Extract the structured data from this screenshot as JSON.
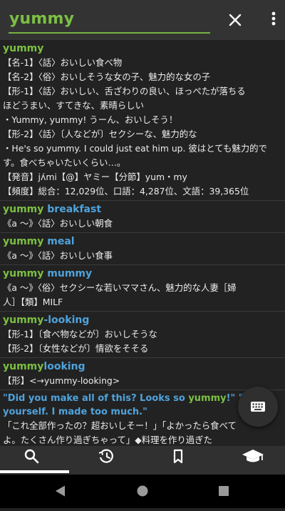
{
  "search": {
    "query": "yummy"
  },
  "icons": {
    "close": "close-icon",
    "menu": "more-vert-icon",
    "keyboard": "keyboard-icon",
    "nav": [
      "search-icon",
      "history-icon",
      "bookmark-icon",
      "school-icon"
    ],
    "system": [
      "back-icon",
      "home-icon",
      "recents-icon"
    ]
  },
  "colors": {
    "headword_green": "#7cc043",
    "headword_blue": "#4fa3dc",
    "background": "#222222"
  },
  "entries": {
    "e1": {
      "headword": "yummy",
      "lines": [
        "【名-1】〈話〉おいしい食べ物",
        "【名-2】〈俗〉おいしそうな女の子、魅力的な女の子",
        "【形-1】〈話〉おいしい、舌ざわりの良い、ほっぺたが落ちる",
        "ほどうまい、すてきな、素晴らしい",
        "・Yummy, yummy! うーん、おいしそう！",
        "【形-2】〈話〉〔人などが〕セクシーな、魅力的な",
        "・He's so yummy. I could just eat him up. 彼はとても魅力的で",
        "す。食べちゃいたいくらい…。",
        "【発音】jʌ́mi【@】ヤミー【分節】yum・my",
        "【頻度】総合：12,029位、口語：4,287位、文語：39,365位"
      ]
    },
    "e2": {
      "hw_green": "yummy",
      "hw_blue": " breakfast",
      "lines": [
        "《a ～》〈話〉おいしい朝食"
      ]
    },
    "e3": {
      "hw_green": "yummy",
      "hw_blue": " meal",
      "lines": [
        "《a ～》〈話〉おいしい食事"
      ]
    },
    "e4": {
      "hw_green": "yummy",
      "hw_blue": " mummy",
      "lines": [
        "《a ～》〈俗〉セクシーな若いママさん、魅力的な人妻［婦",
        "人］【類】MILF"
      ]
    },
    "e5": {
      "hw_green": "yummy",
      "hw_blue": "-looking",
      "lines": [
        "【形-1】〔食べ物などが〕おいしそうな",
        "【形-2】〔女性などが〕情欲をそそる"
      ]
    },
    "e6": {
      "hw_green": "yummy",
      "hw_blue": "looking",
      "lines": [
        "【形】<→yummy-looking>"
      ]
    },
    "e7": {
      "en_pre": "\"Did you make all of this? Looks so ",
      "en_green": "yummy",
      "en_post": "!\" \"Help",
      "en_line2": "yourself. I made too much.\"",
      "lines": [
        "「これ全部作ったの？超おいしそー！」「よかったら食べて",
        "よ。たくさん作り過ぎちゃって」◆料理を作り過ぎた"
      ]
    }
  }
}
